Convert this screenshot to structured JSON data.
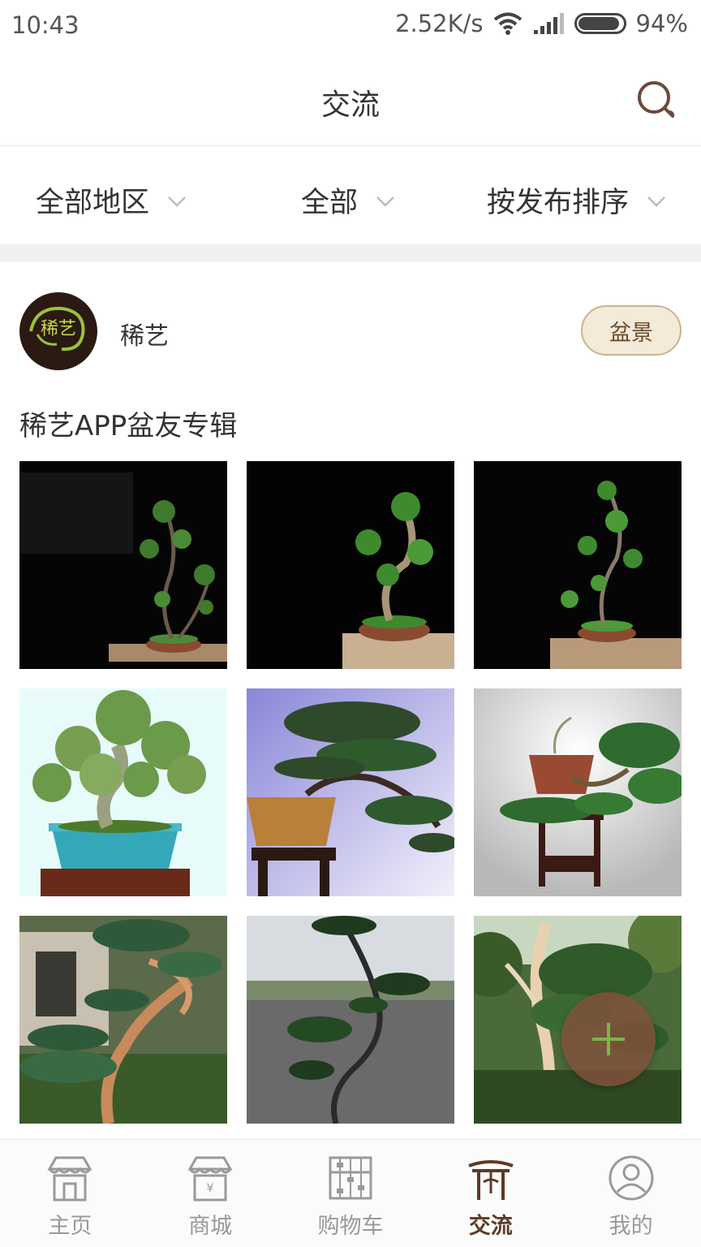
{
  "status_bar": {
    "time": "10:43",
    "net_speed": "2.52K/s",
    "battery": "94%",
    "battery_level": 0.94
  },
  "header": {
    "title": "交流",
    "search_icon": "search-icon"
  },
  "filters": [
    {
      "label": "全部地区"
    },
    {
      "label": "全部"
    },
    {
      "label": "按发布排序"
    }
  ],
  "post": {
    "avatar_text": "稀艺",
    "username": "稀艺",
    "tag": "盆景",
    "title": "稀艺APP盆友专辑",
    "photos": [
      {
        "scene": "bonsai-dark-1"
      },
      {
        "scene": "bonsai-dark-2"
      },
      {
        "scene": "bonsai-dark-3"
      },
      {
        "scene": "bonsai-blue-pot"
      },
      {
        "scene": "bonsai-purple-bg"
      },
      {
        "scene": "bonsai-gray-stand"
      },
      {
        "scene": "bonsai-garden-1"
      },
      {
        "scene": "bonsai-street"
      },
      {
        "scene": "bonsai-garden-2"
      }
    ]
  },
  "fab": {
    "icon": "plus-icon"
  },
  "tabs": [
    {
      "label": "主页",
      "icon": "home-shop-icon"
    },
    {
      "label": "商城",
      "icon": "mall-icon"
    },
    {
      "label": "购物车",
      "icon": "abacus-cart-icon"
    },
    {
      "label": "交流",
      "icon": "pavilion-community-icon",
      "active": true
    },
    {
      "label": "我的",
      "icon": "user-profile-icon"
    }
  ],
  "colors": {
    "accent": "#5e3a25",
    "tag_bg": "#f3ead9",
    "fab": "#82503c"
  }
}
